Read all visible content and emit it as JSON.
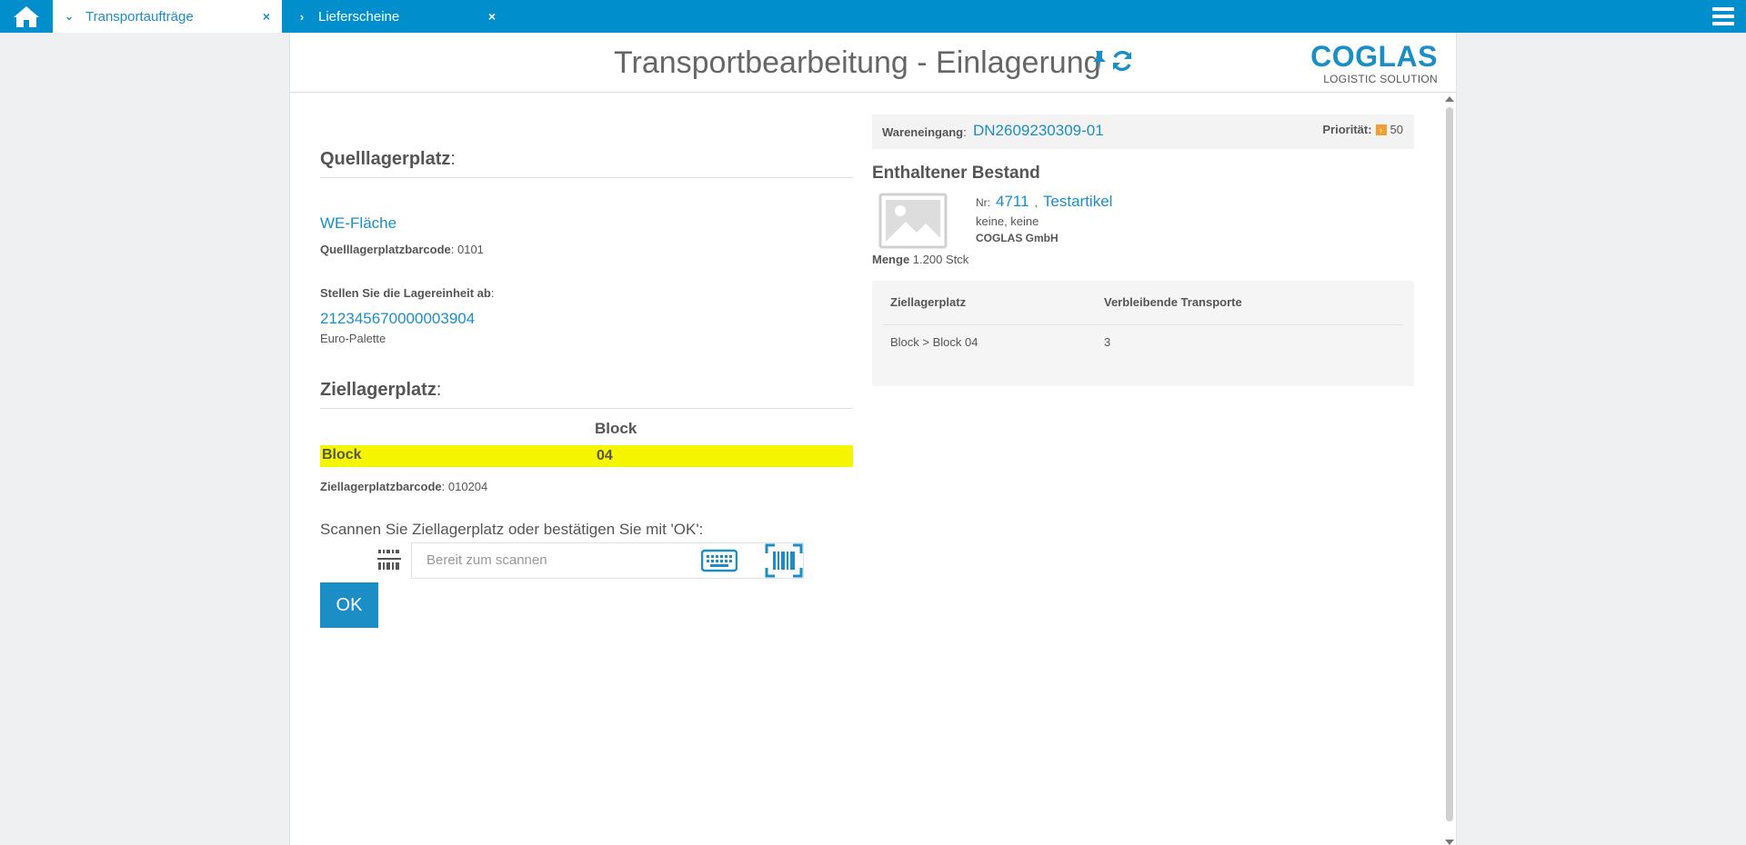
{
  "topbar": {
    "home_icon": "home-icon",
    "tabs": [
      {
        "label": "Transportaufträge",
        "state": "active",
        "chevron": "chevron-down-icon",
        "close": "×"
      },
      {
        "label": "Lieferscheine",
        "state": "inactive",
        "chevron": "chevron-right-icon",
        "close": "×"
      }
    ],
    "menu_icon": "hamburger-menu-icon",
    "color": "#008fcc"
  },
  "header": {
    "title": "Transportbearbeitung - Einlagerung",
    "icons": [
      "pin-icon",
      "refresh-icon"
    ],
    "logo": {
      "main": "COGLAS",
      "sub": "LOGISTIC SOLUTION"
    }
  },
  "source": {
    "title": "Quelllagerplatz",
    "title_colon": ":",
    "location": "WE-Fläche",
    "barcode_label": "Quelllagerplatzbarcode",
    "barcode_value": ": 0101",
    "instruction_label": "Stellen Sie die Lagereinheit ab",
    "instruction_colon": ":",
    "unit_id": "212345670000003904",
    "unit_type": "Euro-Palette"
  },
  "target": {
    "title": "Ziellagerplatz",
    "title_colon": ":",
    "column_header": "Block",
    "row_label": "Block",
    "row_value": "04",
    "barcode_label": "Ziellagerplatzbarcode",
    "barcode_value": ": 010204",
    "highlight_color": "#f5f500"
  },
  "scan": {
    "prompt": "Scannen Sie Ziellagerplatz oder bestätigen Sie mit 'OK':",
    "placeholder": "Bereit zum scannen",
    "ok_label": "OK"
  },
  "receipt": {
    "label": "Wareneingang",
    "colon": ":",
    "number": "DN2609230309-01",
    "priority_label": "Priorität:",
    "priority_value": "50"
  },
  "stock": {
    "title": "Enthaltener Bestand",
    "nr_label": "Nr:",
    "article_no": "4711",
    "separator": ",",
    "article_name": "Testartikel",
    "attributes": "keine, keine",
    "company": "COGLAS GmbH",
    "quantity_label": "Menge",
    "quantity_value": "1.200 Stck"
  },
  "transports_table": {
    "columns": [
      "Ziellagerplatz",
      "Verbleibende Transporte"
    ],
    "rows": [
      [
        "Block > Block 04",
        "3"
      ]
    ]
  }
}
